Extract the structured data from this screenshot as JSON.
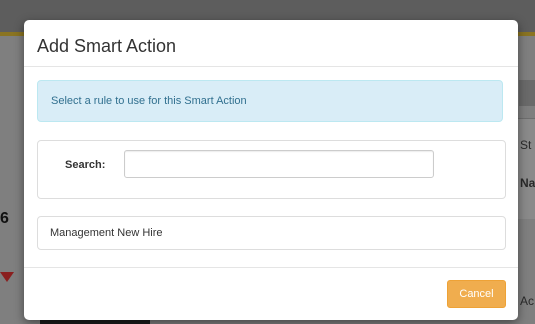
{
  "background": {
    "right_edge_label_1": "St",
    "right_edge_label_2": "Na",
    "right_edge_label_3": "Ac",
    "left_edge_glyph": "6"
  },
  "modal": {
    "title": "Add Smart Action",
    "info_message": "Select a rule to use for this Smart Action",
    "search": {
      "label": "Search:",
      "value": "",
      "placeholder": ""
    },
    "rules": [
      {
        "label": "Management New Hire"
      }
    ],
    "cancel_label": "Cancel"
  },
  "colors": {
    "info_background": "#d9edf7",
    "info_text": "#31708f",
    "cancel_button": "#f0ad4e",
    "background_accent": "#8a7422"
  }
}
